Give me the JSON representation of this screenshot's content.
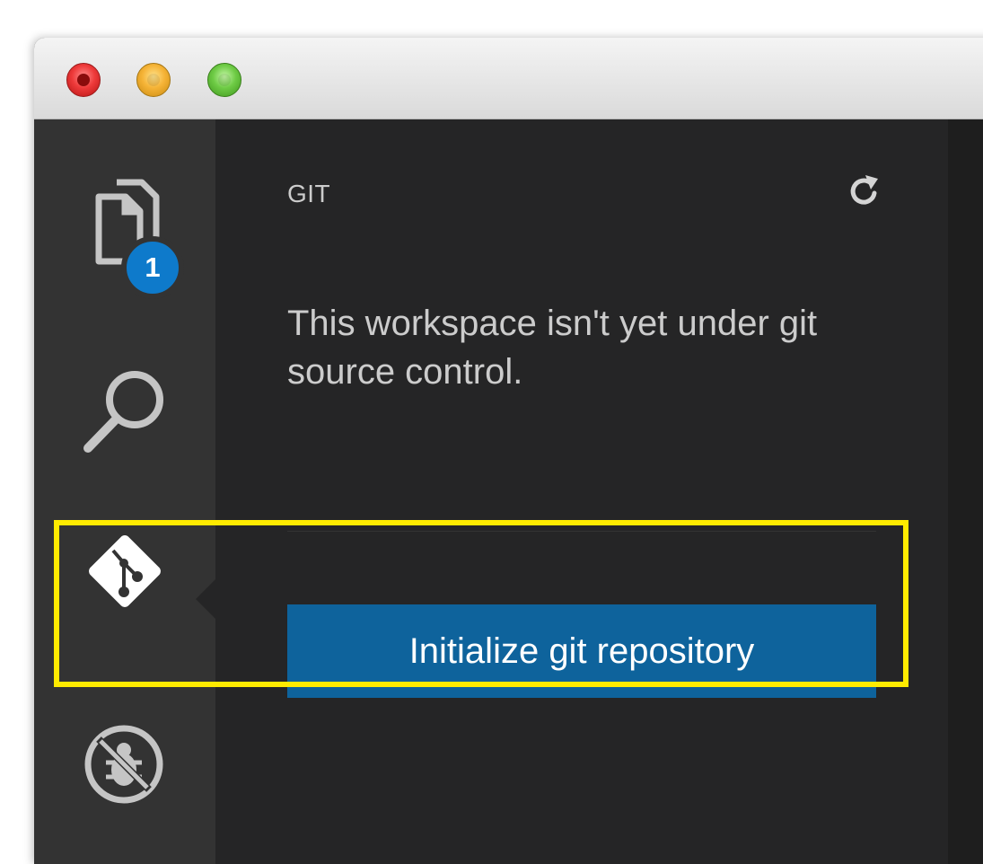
{
  "window": {
    "controls": [
      "close",
      "minimize",
      "zoom"
    ]
  },
  "activity_bar": {
    "items": [
      {
        "icon": "files-icon",
        "badge": "1"
      },
      {
        "icon": "search-icon"
      },
      {
        "icon": "git-icon",
        "active": true
      },
      {
        "icon": "debug-icon"
      }
    ]
  },
  "git_panel": {
    "title": "GIT",
    "refresh_icon": "refresh-icon",
    "message": "This workspace isn't yet under git source control.",
    "init_button_label": "Initialize git repository"
  },
  "annotation": {
    "highlight_color": "#ffeb00"
  },
  "colors": {
    "activity_bar": "#333333",
    "sidebar": "#252526",
    "button": "#0e639c",
    "badge": "#0e7acb"
  }
}
